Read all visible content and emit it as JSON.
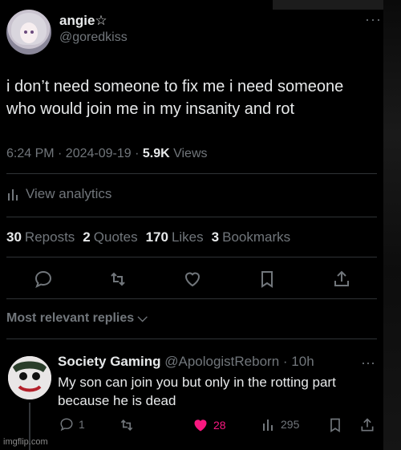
{
  "post": {
    "author_name": "angie☆",
    "author_handle": "@goredkiss",
    "text": "i don’t need someone to fix me i need someone who would join me in my insanity and rot",
    "time": "6:24 PM · 2024-09-19 · ",
    "views_count": "5.9K",
    "views_label": " Views",
    "analytics_label": "View analytics"
  },
  "stats": [
    {
      "count": "30",
      "label": "Reposts"
    },
    {
      "count": "2",
      "label": "Quotes"
    },
    {
      "count": "170",
      "label": "Likes"
    },
    {
      "count": "3",
      "label": "Bookmarks"
    }
  ],
  "replies_sort_label": "Most relevant replies",
  "reply": {
    "author_name": "Society Gaming",
    "author_handle": "@ApologistReborn",
    "time": "· 10h",
    "text": "My son can join you but only in the rotting part because he is dead",
    "reply_count": "1",
    "like_count": "28",
    "view_count": "295"
  },
  "watermark": "imgflip.com",
  "colors": {
    "background": "#000000",
    "text": "#e7e9ea",
    "muted": "#71767b",
    "like": "#f91880",
    "divider": "#2f3336"
  }
}
